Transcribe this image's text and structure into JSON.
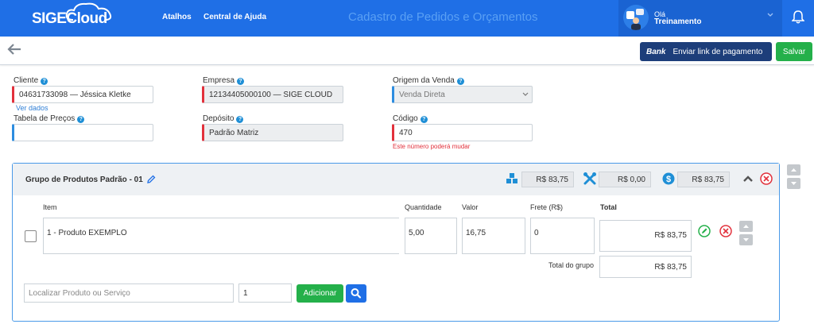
{
  "header": {
    "logo_part1": "SIGE",
    "logo_part2": "Cloud",
    "nav": [
      "Atalhos",
      "Central de Ajuda"
    ],
    "title": "Cadastro de Pedidos e Orçamentos",
    "user_greeting": "Olá",
    "user_name": "Treinamento"
  },
  "toolbar": {
    "link_button_brand": "Bank",
    "link_button_label": "Enviar link de pagamento",
    "save_label": "Salvar"
  },
  "form": {
    "cliente_label": "Cliente",
    "cliente_value": "04631733098 — Jéssica Kletke",
    "ver_dados": "Ver dados",
    "empresa_label": "Empresa",
    "empresa_value": "12134405000100 — SIGE CLOUD",
    "origem_label": "Origem da Venda",
    "origem_value": "Venda Direta",
    "tabela_label": "Tabela de Preços",
    "tabela_value": "",
    "deposito_label": "Depósito",
    "deposito_value": "Padrão Matriz",
    "codigo_label": "Código",
    "codigo_value": "470",
    "codigo_warning": "Este número poderá mudar"
  },
  "group": {
    "title": "Grupo de Produtos Padrão - 01",
    "sum_products": "R$ 83,75",
    "sum_services": "R$ 0,00",
    "sum_total": "R$ 83,75",
    "columns": {
      "item": "Item",
      "quantidade": "Quantidade",
      "valor": "Valor",
      "frete": "Frete (R$)",
      "total": "Total"
    },
    "row": {
      "item": "1 - Produto EXEMPLO",
      "quantidade": "5,00",
      "valor": "16,75",
      "frete": "0",
      "total": "R$ 83,75"
    },
    "total_grupo_label": "Total do grupo",
    "total_grupo_value": "R$ 83,75",
    "search_placeholder": "Localizar Produto ou Serviço",
    "add_quantity": "1",
    "add_label": "Adicionar"
  },
  "colors": {
    "primary": "#1f6fe6",
    "success": "#24b04a",
    "danger": "#e2313c",
    "dark_button": "#1d3e7a"
  }
}
